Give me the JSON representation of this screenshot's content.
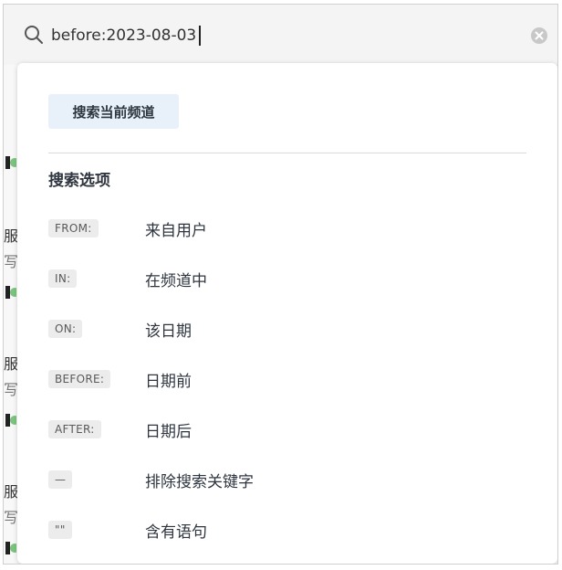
{
  "search": {
    "value": "before:2023-08-03",
    "icon": "search-icon",
    "clear_icon": "clear-icon"
  },
  "dropdown": {
    "scope_button": "搜索当前频道",
    "options_title": "搜索选项",
    "options": [
      {
        "chip": "FROM:",
        "label": "来自用户"
      },
      {
        "chip": "IN:",
        "label": "在频道中"
      },
      {
        "chip": "ON:",
        "label": "该日期"
      },
      {
        "chip": "BEFORE:",
        "label": "日期前"
      },
      {
        "chip": "AFTER:",
        "label": "日期后"
      },
      {
        "chip": "—",
        "label": "排除搜索关键字"
      },
      {
        "chip": "\"\"",
        "label": "含有语句"
      }
    ]
  },
  "background": {
    "snippets": [
      "服",
      "写",
      "服",
      "写",
      "服",
      "写"
    ]
  },
  "colors": {
    "accent_bg": "#e8f1fa",
    "chip_bg": "#ececec",
    "text": "#2f3640"
  }
}
